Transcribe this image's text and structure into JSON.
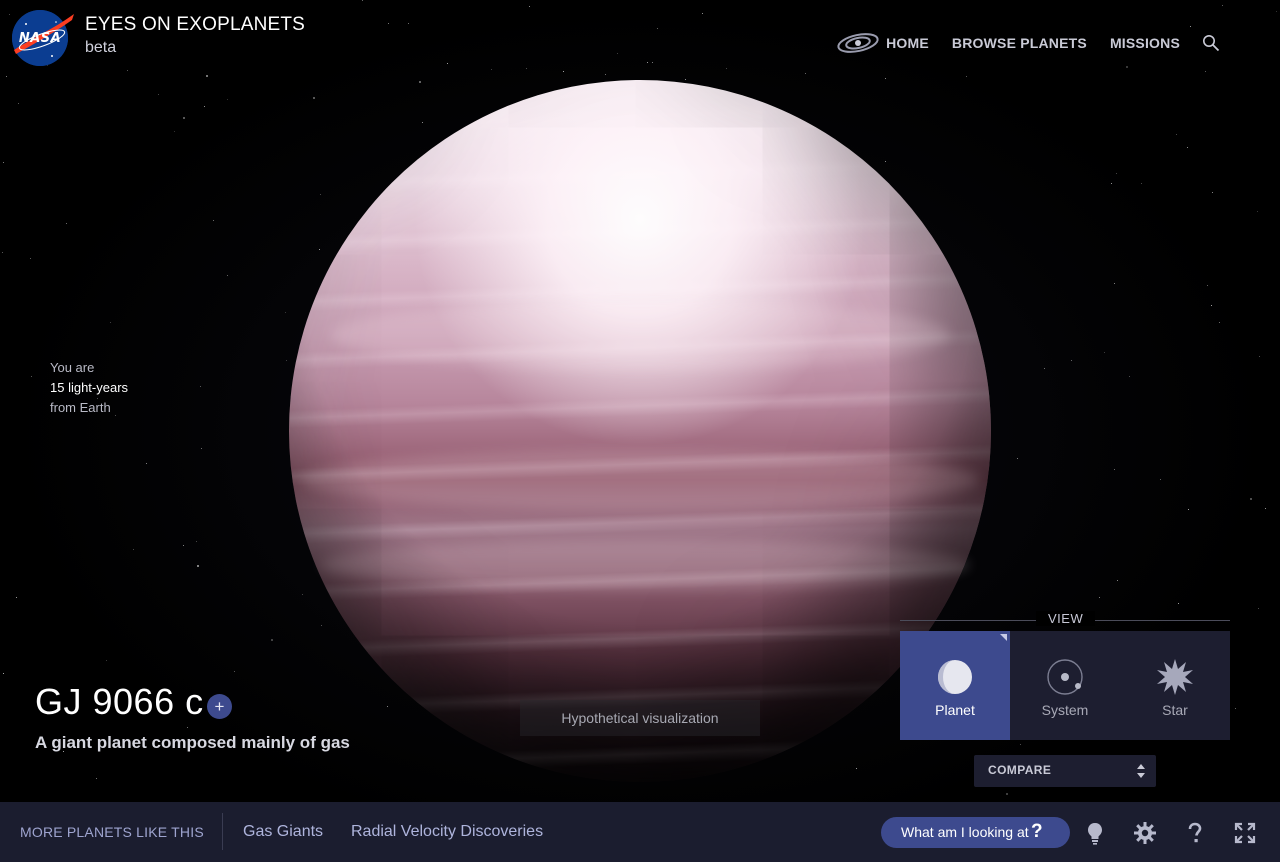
{
  "app": {
    "title": "EYES ON EXOPLANETS",
    "subtitle": "beta",
    "logo_text": "NASA"
  },
  "nav": {
    "items": [
      {
        "label": "HOME",
        "icon": "galaxy-icon"
      },
      {
        "label": "BROWSE PLANETS"
      },
      {
        "label": "MISSIONS"
      }
    ],
    "search_icon": "search-icon"
  },
  "distance": {
    "line1": "You are",
    "line2": "15 light-years",
    "line3": "from Earth"
  },
  "planet": {
    "name": "GJ 9066 c",
    "add_label": "+",
    "description": "A giant planet composed mainly of gas",
    "visualization_note": "Hypothetical visualization"
  },
  "view": {
    "label": "VIEW",
    "options": [
      {
        "label": "Planet",
        "icon": "planet-icon",
        "active": true
      },
      {
        "label": "System",
        "icon": "system-icon",
        "active": false
      },
      {
        "label": "Star",
        "icon": "star-icon",
        "active": false
      }
    ],
    "compare_label": "COMPARE"
  },
  "bottom_bar": {
    "more_label": "MORE PLANETS LIKE THIS",
    "links": [
      "Gas Giants",
      "Radial Velocity Discoveries"
    ],
    "help_button_label": "What am I looking at",
    "help_button_glyph": "?",
    "icons": [
      "lightbulb-icon",
      "gear-icon",
      "help-icon",
      "fullscreen-icon"
    ]
  },
  "colors": {
    "accent": "#3d4a8e",
    "panel": "#1d1e30",
    "bar": "#1b1d2f",
    "nasa_blue": "#0b3d91",
    "nasa_red": "#fc3d21"
  }
}
